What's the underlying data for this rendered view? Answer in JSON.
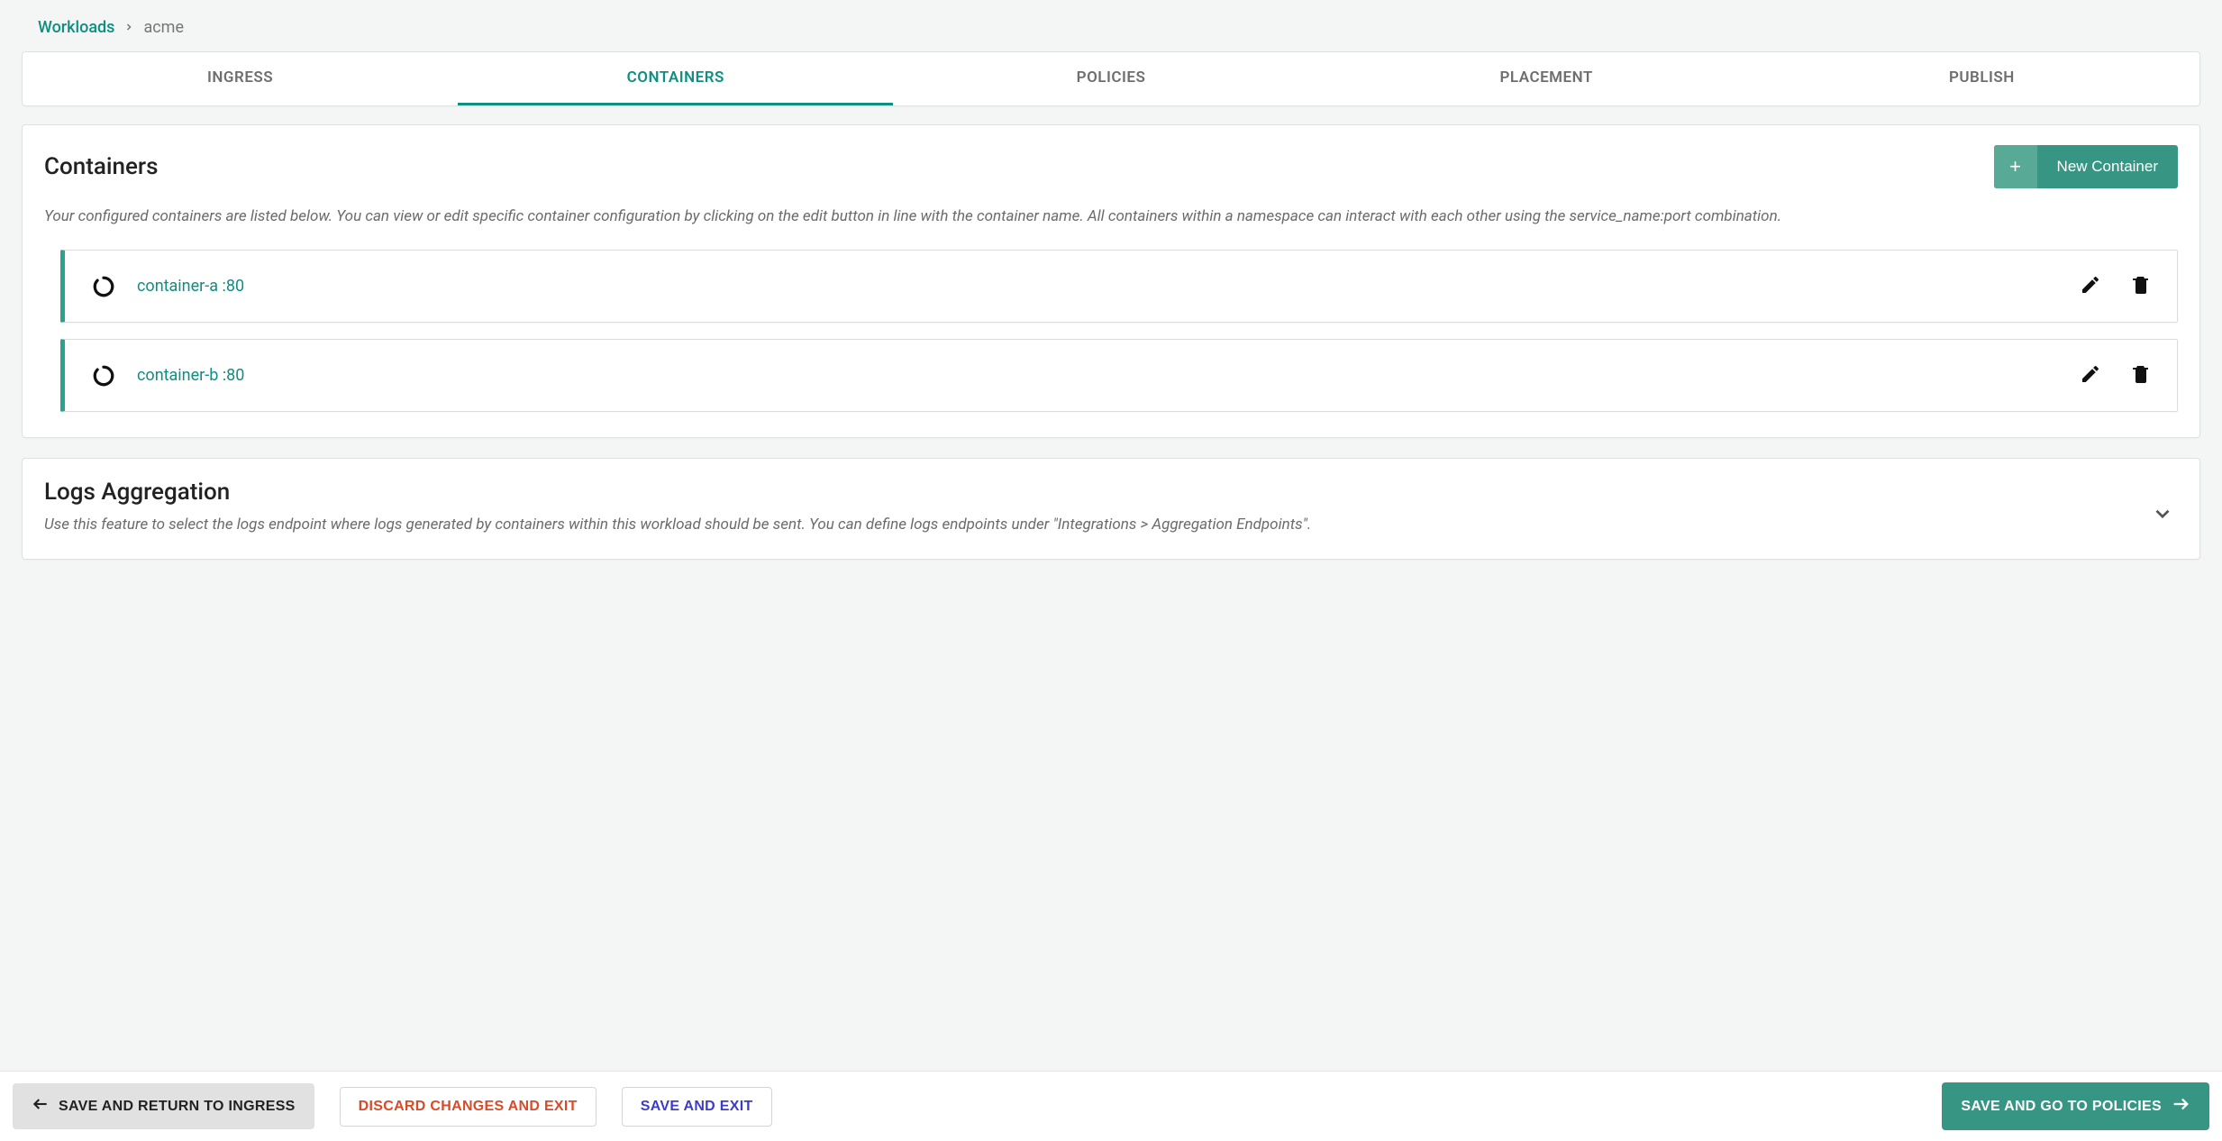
{
  "breadcrumb": {
    "root": "Workloads",
    "current": "acme"
  },
  "tabs": [
    {
      "label": "INGRESS",
      "active": false
    },
    {
      "label": "CONTAINERS",
      "active": true
    },
    {
      "label": "POLICIES",
      "active": false
    },
    {
      "label": "PLACEMENT",
      "active": false
    },
    {
      "label": "PUBLISH",
      "active": false
    }
  ],
  "containers_section": {
    "title": "Containers",
    "new_button": "New Container",
    "description": "Your configured containers are listed below. You can view or edit specific container configuration by clicking on the edit button in line with the container name. All containers within a namespace can interact with each other using the service_name:port combination.",
    "items": [
      {
        "name": "container-a :80"
      },
      {
        "name": "container-b :80"
      }
    ]
  },
  "logs_section": {
    "title": "Logs Aggregation",
    "description": "Use this feature to select the logs endpoint where logs generated by containers within this workload should be sent. You can define logs endpoints under \"Integrations > Aggregation Endpoints\"."
  },
  "footer": {
    "back": "SAVE AND RETURN TO INGRESS",
    "discard": "DISCARD CHANGES AND EXIT",
    "save_exit": "SAVE AND EXIT",
    "next": "SAVE AND GO TO POLICIES"
  }
}
